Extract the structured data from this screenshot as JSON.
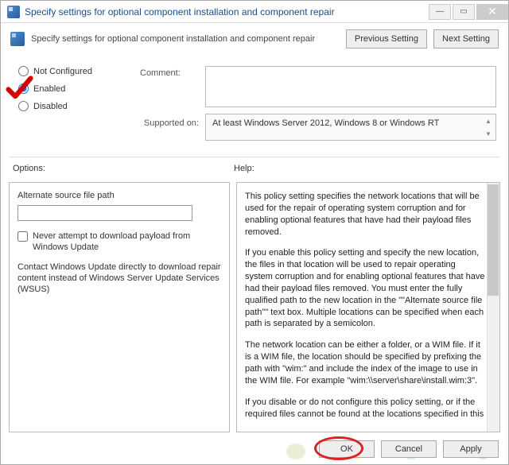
{
  "titlebar": {
    "title": "Specify settings for optional component installation and component repair"
  },
  "header": {
    "description": "Specify settings for optional component installation and component repair",
    "prev_btn": "Previous Setting",
    "next_btn": "Next Setting"
  },
  "radios": {
    "not_configured": "Not Configured",
    "enabled": "Enabled",
    "disabled": "Disabled",
    "selected": "enabled"
  },
  "fields": {
    "comment_label": "Comment:",
    "comment_value": "",
    "supported_label": "Supported on:",
    "supported_value": "At least Windows Server 2012, Windows 8 or Windows RT"
  },
  "columns": {
    "options_label": "Options:",
    "help_label": "Help:"
  },
  "options": {
    "alt_path_label": "Alternate source file path",
    "alt_path_value": "",
    "never_download_label": "Never attempt to download payload from Windows Update",
    "never_download_checked": false,
    "contact_wu_label": "Contact Windows Update directly to download repair content instead of Windows Server Update Services (WSUS)"
  },
  "help": {
    "p1": "This policy setting specifies the network locations that will be used for the repair of operating system corruption and for enabling optional features that have had their payload files removed.",
    "p2": "If you enable this policy setting and specify the new location, the files in that location will be used to repair operating system corruption and for enabling optional features that have had their payload files removed. You must enter the fully qualified path to the new location in the \"\"Alternate source file path\"\" text box. Multiple locations can be specified when each path is separated by a semicolon.",
    "p3": "The network location can be either a folder, or a WIM file. If it is a WIM file, the location should be specified by prefixing the path with \"wim:\" and include the index of the image to use in the WIM file. For example \"wim:\\\\server\\share\\install.wim:3\".",
    "p4": "If you disable or do not configure this policy setting, or if the required files cannot be found at the locations specified in this"
  },
  "buttons": {
    "ok": "OK",
    "cancel": "Cancel",
    "apply": "Apply"
  }
}
